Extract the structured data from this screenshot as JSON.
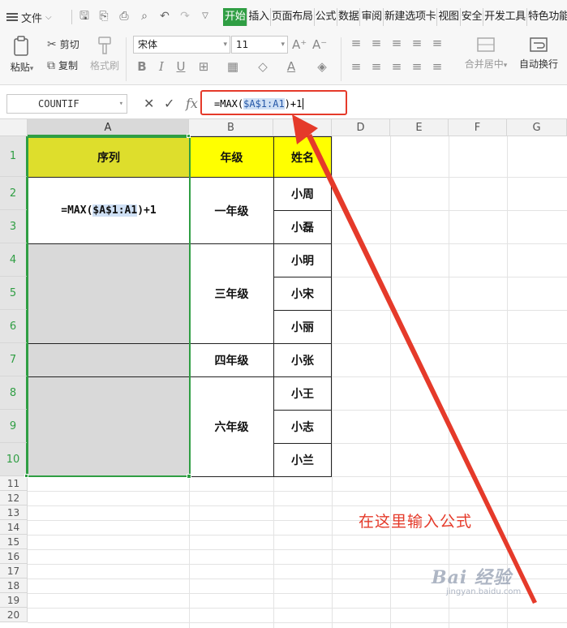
{
  "menubar": {
    "file_label": "文件",
    "tabs": [
      {
        "label": "开始",
        "active": true
      },
      {
        "label": "插入"
      },
      {
        "label": "页面布局"
      },
      {
        "label": "公式"
      },
      {
        "label": "数据"
      },
      {
        "label": "审阅"
      },
      {
        "label": "新建选项卡"
      },
      {
        "label": "视图"
      },
      {
        "label": "安全"
      },
      {
        "label": "开发工具"
      },
      {
        "label": "特色功能"
      }
    ]
  },
  "ribbon": {
    "paste_label": "粘贴",
    "cut_label": "剪切",
    "copy_label": "复制",
    "format_painter_label": "格式刷",
    "font_name": "宋体",
    "font_size": "11",
    "merge_center_label": "合并居中",
    "wrap_text_label": "自动换行"
  },
  "formula_bar": {
    "name_box": "COUNTIF",
    "fx_label": "fx",
    "formula_prefix": "=MAX(",
    "formula_ref": "$A$1:A1",
    "formula_suffix": ")+1"
  },
  "columns": [
    "A",
    "B",
    "C",
    "D",
    "E",
    "F",
    "G"
  ],
  "rows": [
    "1",
    "2",
    "3",
    "4",
    "5",
    "6",
    "7",
    "8",
    "9",
    "10",
    "11",
    "12",
    "13",
    "14",
    "15",
    "16",
    "17",
    "18",
    "19",
    "20"
  ],
  "table": {
    "header": {
      "seq": "序列",
      "grade": "年级",
      "name": "姓名"
    },
    "cell_formula": {
      "prefix": "=MAX(",
      "ref": "$A$1:A1",
      "suffix": ")+1"
    },
    "grades": [
      "一年级",
      "三年级",
      "四年级",
      "六年级"
    ],
    "names": [
      "小周",
      "小磊",
      "小明",
      "小宋",
      "小丽",
      "小张",
      "小王",
      "小志",
      "小兰"
    ]
  },
  "annotation": {
    "note": "在这里输入公式",
    "colors": {
      "arrow": "#e53a2a",
      "accent": "#2f9e43",
      "header_fill_a": "#dede2c",
      "header_fill_bc": "#ffff00",
      "blank_fill": "#d9d9d9"
    }
  },
  "watermark": {
    "main": "Bai 经验",
    "sub": "jingyan.baidu.com"
  }
}
